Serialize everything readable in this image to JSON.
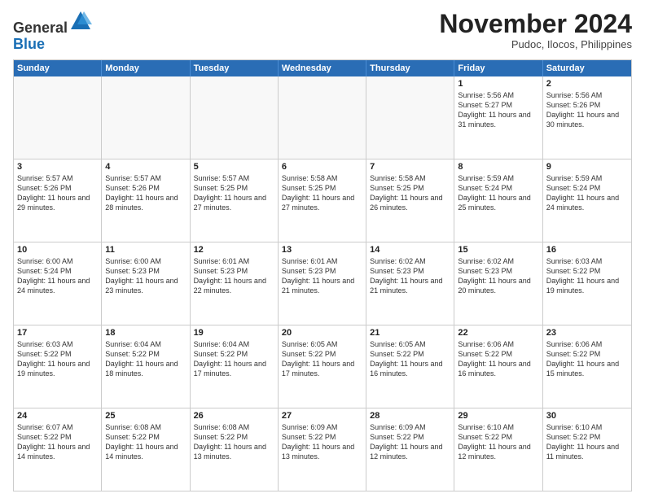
{
  "header": {
    "logo_line1": "General",
    "logo_line2": "Blue",
    "month": "November 2024",
    "location": "Pudoc, Ilocos, Philippines"
  },
  "weekdays": [
    "Sunday",
    "Monday",
    "Tuesday",
    "Wednesday",
    "Thursday",
    "Friday",
    "Saturday"
  ],
  "rows": [
    [
      {
        "day": "",
        "text": "",
        "empty": true
      },
      {
        "day": "",
        "text": "",
        "empty": true
      },
      {
        "day": "",
        "text": "",
        "empty": true
      },
      {
        "day": "",
        "text": "",
        "empty": true
      },
      {
        "day": "",
        "text": "",
        "empty": true
      },
      {
        "day": "1",
        "text": "Sunrise: 5:56 AM\nSunset: 5:27 PM\nDaylight: 11 hours and 31 minutes.",
        "empty": false
      },
      {
        "day": "2",
        "text": "Sunrise: 5:56 AM\nSunset: 5:26 PM\nDaylight: 11 hours and 30 minutes.",
        "empty": false
      }
    ],
    [
      {
        "day": "3",
        "text": "Sunrise: 5:57 AM\nSunset: 5:26 PM\nDaylight: 11 hours and 29 minutes.",
        "empty": false
      },
      {
        "day": "4",
        "text": "Sunrise: 5:57 AM\nSunset: 5:26 PM\nDaylight: 11 hours and 28 minutes.",
        "empty": false
      },
      {
        "day": "5",
        "text": "Sunrise: 5:57 AM\nSunset: 5:25 PM\nDaylight: 11 hours and 27 minutes.",
        "empty": false
      },
      {
        "day": "6",
        "text": "Sunrise: 5:58 AM\nSunset: 5:25 PM\nDaylight: 11 hours and 27 minutes.",
        "empty": false
      },
      {
        "day": "7",
        "text": "Sunrise: 5:58 AM\nSunset: 5:25 PM\nDaylight: 11 hours and 26 minutes.",
        "empty": false
      },
      {
        "day": "8",
        "text": "Sunrise: 5:59 AM\nSunset: 5:24 PM\nDaylight: 11 hours and 25 minutes.",
        "empty": false
      },
      {
        "day": "9",
        "text": "Sunrise: 5:59 AM\nSunset: 5:24 PM\nDaylight: 11 hours and 24 minutes.",
        "empty": false
      }
    ],
    [
      {
        "day": "10",
        "text": "Sunrise: 6:00 AM\nSunset: 5:24 PM\nDaylight: 11 hours and 24 minutes.",
        "empty": false
      },
      {
        "day": "11",
        "text": "Sunrise: 6:00 AM\nSunset: 5:23 PM\nDaylight: 11 hours and 23 minutes.",
        "empty": false
      },
      {
        "day": "12",
        "text": "Sunrise: 6:01 AM\nSunset: 5:23 PM\nDaylight: 11 hours and 22 minutes.",
        "empty": false
      },
      {
        "day": "13",
        "text": "Sunrise: 6:01 AM\nSunset: 5:23 PM\nDaylight: 11 hours and 21 minutes.",
        "empty": false
      },
      {
        "day": "14",
        "text": "Sunrise: 6:02 AM\nSunset: 5:23 PM\nDaylight: 11 hours and 21 minutes.",
        "empty": false
      },
      {
        "day": "15",
        "text": "Sunrise: 6:02 AM\nSunset: 5:23 PM\nDaylight: 11 hours and 20 minutes.",
        "empty": false
      },
      {
        "day": "16",
        "text": "Sunrise: 6:03 AM\nSunset: 5:22 PM\nDaylight: 11 hours and 19 minutes.",
        "empty": false
      }
    ],
    [
      {
        "day": "17",
        "text": "Sunrise: 6:03 AM\nSunset: 5:22 PM\nDaylight: 11 hours and 19 minutes.",
        "empty": false
      },
      {
        "day": "18",
        "text": "Sunrise: 6:04 AM\nSunset: 5:22 PM\nDaylight: 11 hours and 18 minutes.",
        "empty": false
      },
      {
        "day": "19",
        "text": "Sunrise: 6:04 AM\nSunset: 5:22 PM\nDaylight: 11 hours and 17 minutes.",
        "empty": false
      },
      {
        "day": "20",
        "text": "Sunrise: 6:05 AM\nSunset: 5:22 PM\nDaylight: 11 hours and 17 minutes.",
        "empty": false
      },
      {
        "day": "21",
        "text": "Sunrise: 6:05 AM\nSunset: 5:22 PM\nDaylight: 11 hours and 16 minutes.",
        "empty": false
      },
      {
        "day": "22",
        "text": "Sunrise: 6:06 AM\nSunset: 5:22 PM\nDaylight: 11 hours and 16 minutes.",
        "empty": false
      },
      {
        "day": "23",
        "text": "Sunrise: 6:06 AM\nSunset: 5:22 PM\nDaylight: 11 hours and 15 minutes.",
        "empty": false
      }
    ],
    [
      {
        "day": "24",
        "text": "Sunrise: 6:07 AM\nSunset: 5:22 PM\nDaylight: 11 hours and 14 minutes.",
        "empty": false
      },
      {
        "day": "25",
        "text": "Sunrise: 6:08 AM\nSunset: 5:22 PM\nDaylight: 11 hours and 14 minutes.",
        "empty": false
      },
      {
        "day": "26",
        "text": "Sunrise: 6:08 AM\nSunset: 5:22 PM\nDaylight: 11 hours and 13 minutes.",
        "empty": false
      },
      {
        "day": "27",
        "text": "Sunrise: 6:09 AM\nSunset: 5:22 PM\nDaylight: 11 hours and 13 minutes.",
        "empty": false
      },
      {
        "day": "28",
        "text": "Sunrise: 6:09 AM\nSunset: 5:22 PM\nDaylight: 11 hours and 12 minutes.",
        "empty": false
      },
      {
        "day": "29",
        "text": "Sunrise: 6:10 AM\nSunset: 5:22 PM\nDaylight: 11 hours and 12 minutes.",
        "empty": false
      },
      {
        "day": "30",
        "text": "Sunrise: 6:10 AM\nSunset: 5:22 PM\nDaylight: 11 hours and 11 minutes.",
        "empty": false
      }
    ]
  ]
}
